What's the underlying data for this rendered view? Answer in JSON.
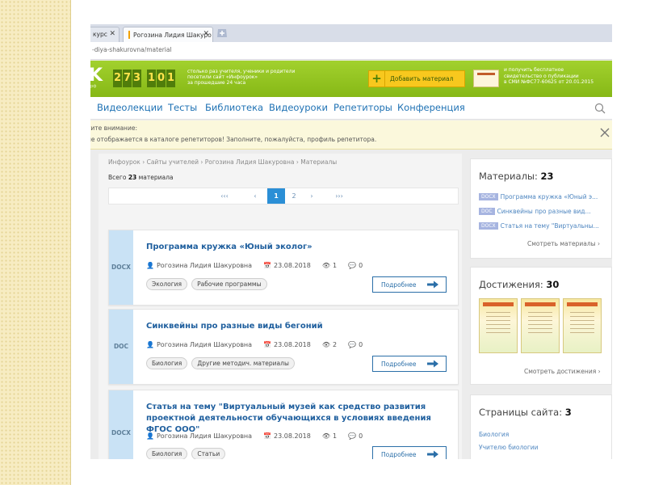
{
  "browser": {
    "tabs": [
      {
        "label": "курс"
      },
      {
        "label": "Рогозина Лидия Шакуро"
      }
    ],
    "address": "-diya-shakurovna/material"
  },
  "banner": {
    "logo_fragment": "K",
    "logo_sub": "pф",
    "counter_digits": [
      "2",
      "7",
      "3",
      "1",
      "0",
      "1"
    ],
    "counter_text_lines": [
      "столько раз учителя, ученики и родители",
      "посетили сайт «Инфоурок»",
      "за прошедшие 24 часа"
    ],
    "add_plus": "+",
    "add_label": "Добавить материал",
    "cert_text_lines": [
      "и получить бесплатное",
      "свидетельство о публикации",
      "в СМИ №ФС77-60625 от 20.01.2015"
    ]
  },
  "nav": {
    "items": [
      "Видеолекции",
      "Тесты",
      "Библиотека",
      "Видеоуроки",
      "Репетиторы",
      "Конференция"
    ]
  },
  "notice": {
    "title": "тите внимание:",
    "text": "не отображается в каталоге репетиторов! Заполните, пожалуйста, профиль репетитора.",
    "close": "✕"
  },
  "main": {
    "breadcrumb": "Инфоурок › Сайты учителей › Рогозина Лидия Шакуровна › Материалы",
    "total_prefix": "Всего",
    "total_count": "23",
    "total_suffix": "материала",
    "pager": {
      "first": "‹‹‹",
      "prev": "‹",
      "pages": [
        "1",
        "2"
      ],
      "active": "1",
      "next": "›",
      "last": "›››"
    },
    "cards": [
      {
        "type": "DOCX",
        "title": "Программа кружка «Юный эколог»",
        "author": "Рогозина Лидия Шакуровна",
        "date": "23.08.2018",
        "views": "1",
        "comments": "0",
        "tags": [
          "Экология",
          "Рабочие программы"
        ],
        "button": "Подробнее"
      },
      {
        "type": "DOC",
        "title": "Синквейны про разные виды бегоний",
        "author": "Рогозина Лидия Шакуровна",
        "date": "23.08.2018",
        "views": "2",
        "comments": "0",
        "tags": [
          "Биология",
          "Другие методич. материалы"
        ],
        "button": "Подробнее"
      },
      {
        "type": "DOCX",
        "title": "Статья на тему \"Виртуальный музей как средство развития проектной деятельности обучающихся в условиях введения ФГОС ООО\"",
        "author": "Рогозина Лидия Шакуровна",
        "date": "23.08.2018",
        "views": "1",
        "comments": "0",
        "tags": [
          "Биология",
          "Статьи"
        ],
        "button": "Подробнее"
      }
    ]
  },
  "sidebar": {
    "materials": {
      "title": "Материалы:",
      "count": "23",
      "items": [
        {
          "badge": "DOCX",
          "text": "Программа кружка «Юный э..."
        },
        {
          "badge": "DOC",
          "text": "Синквейны про разные вид..."
        },
        {
          "badge": "DOCX",
          "text": "Статья на тему \"Виртуальны..."
        }
      ],
      "link": "Смотреть материалы ›"
    },
    "achievements": {
      "title": "Достижения:",
      "count": "30",
      "link": "Смотреть достижения ›"
    },
    "pages": {
      "title": "Страницы сайта:",
      "count": "3",
      "items": [
        "Биология",
        "Учителю биологии"
      ]
    }
  },
  "colors": {
    "accent_green": "#8cbf1e",
    "link_blue": "#1f72b4",
    "active_page": "#2b8fd6",
    "type_badge": "#c9e2f5"
  }
}
